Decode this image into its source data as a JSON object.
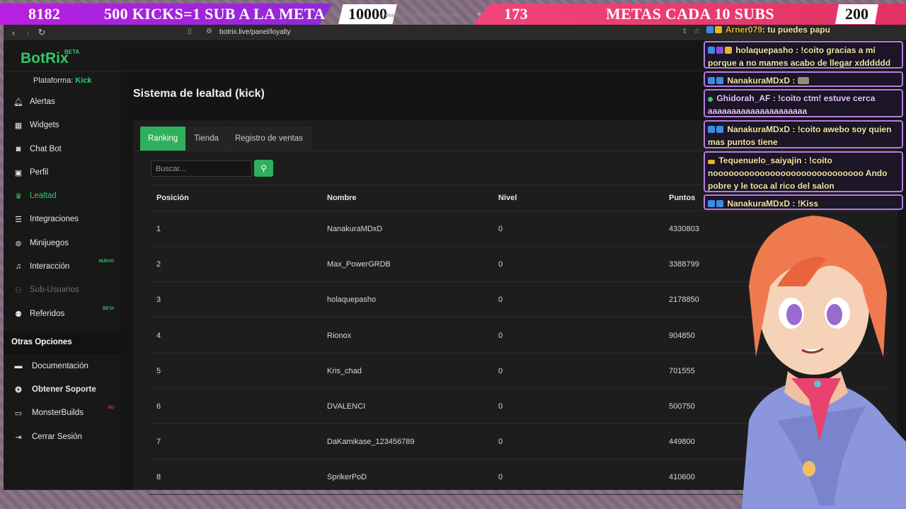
{
  "overlay": {
    "left_count": "8182",
    "left_goal": "500 KICKS=1 SUB A LA META",
    "center_count": "10000",
    "right_count": "173",
    "right_goal": "METAS CADA 10 SUBS",
    "right_target": "200",
    "colors": {
      "left": "#b81fe0",
      "right": "#e23264"
    }
  },
  "browser": {
    "tab_ghost_text": "o Aleatoria - Selector Personaliz",
    "url": "botrix.live/panel/loyalty"
  },
  "sidebar": {
    "brand": "BotRix",
    "brand_badge": "BETA",
    "platform_label": "Plataforma:",
    "platform_value": "Kick",
    "items": [
      {
        "label": "Alertas",
        "icon": "bell-icon"
      },
      {
        "label": "Widgets",
        "icon": "grid-icon"
      },
      {
        "label": "Chat Bot",
        "icon": "robot-icon"
      },
      {
        "label": "Perfil",
        "icon": "id-card-icon"
      },
      {
        "label": "Lealtad",
        "icon": "trophy-icon"
      },
      {
        "label": "Integraciones",
        "icon": "list-icon"
      },
      {
        "label": "Minijuegos",
        "icon": "gamepad-icon"
      },
      {
        "label": "Interacción",
        "icon": "music-icon",
        "badge": "NUEVO"
      },
      {
        "label": "Sub-Usuarios",
        "icon": "users-icon"
      },
      {
        "label": "Referidos",
        "icon": "user-group-icon",
        "badge": "BETA"
      }
    ],
    "other_title": "Otras Opciones",
    "other_items": [
      {
        "label": "Documentación",
        "icon": "book-icon"
      },
      {
        "label": "Obtener Soporte",
        "icon": "support-icon"
      },
      {
        "label": "MonsterBuilds",
        "icon": "monitor-icon",
        "badge": "AD"
      },
      {
        "label": "Cerrar Sesión",
        "icon": "logout-icon"
      }
    ],
    "accent": "#2fca6a"
  },
  "page": {
    "title": "Sistema de lealtad (kick)",
    "tabs": [
      "Ranking",
      "Tienda",
      "Registro de ventas"
    ],
    "search_placeholder": "Buscar...",
    "columns": [
      "Posición",
      "Nombre",
      "Nivel",
      "Puntos"
    ],
    "rows": [
      {
        "pos": "1",
        "name": "NanakuraMDxD",
        "level": "0",
        "points": "4330803"
      },
      {
        "pos": "2",
        "name": "Max_PowerGRDB",
        "level": "0",
        "points": "3388799"
      },
      {
        "pos": "3",
        "name": "holaquepasho",
        "level": "0",
        "points": "2178850"
      },
      {
        "pos": "4",
        "name": "Rionox",
        "level": "0",
        "points": "904850"
      },
      {
        "pos": "5",
        "name": "Kris_chad",
        "level": "0",
        "points": "701555"
      },
      {
        "pos": "6",
        "name": "DVALENCI",
        "level": "0",
        "points": "500750"
      },
      {
        "pos": "7",
        "name": "DaKamikase_123456789",
        "level": "0",
        "points": "449800"
      },
      {
        "pos": "8",
        "name": "SprikerPoD",
        "level": "0",
        "points": "410600"
      }
    ]
  },
  "chat": [
    {
      "user": "Arner079",
      "text": ": tu puedes papu"
    },
    {
      "user": "holaquepasho",
      "text": ": !coito gracias a mí porque a no mames acabo de llegar xdddddd"
    },
    {
      "user": "NanakuraMDxD",
      "text": ":"
    },
    {
      "user": "Ghidorah_AF",
      "text": ": !coito ctm! estuve cerca aaaaaaaaaaaaaaaaaaaaa"
    },
    {
      "user": "NanakuraMDxD",
      "text": ": !coito awebo soy quien mas puntos tiene"
    },
    {
      "user": "Tequenuelo_saiyajin",
      "text": ": !coito nooooooooooooooooooooooooooooo Ando pobre y le toca al rico del salon"
    },
    {
      "user": "NanakuraMDxD",
      "text": ": !Kiss"
    }
  ]
}
